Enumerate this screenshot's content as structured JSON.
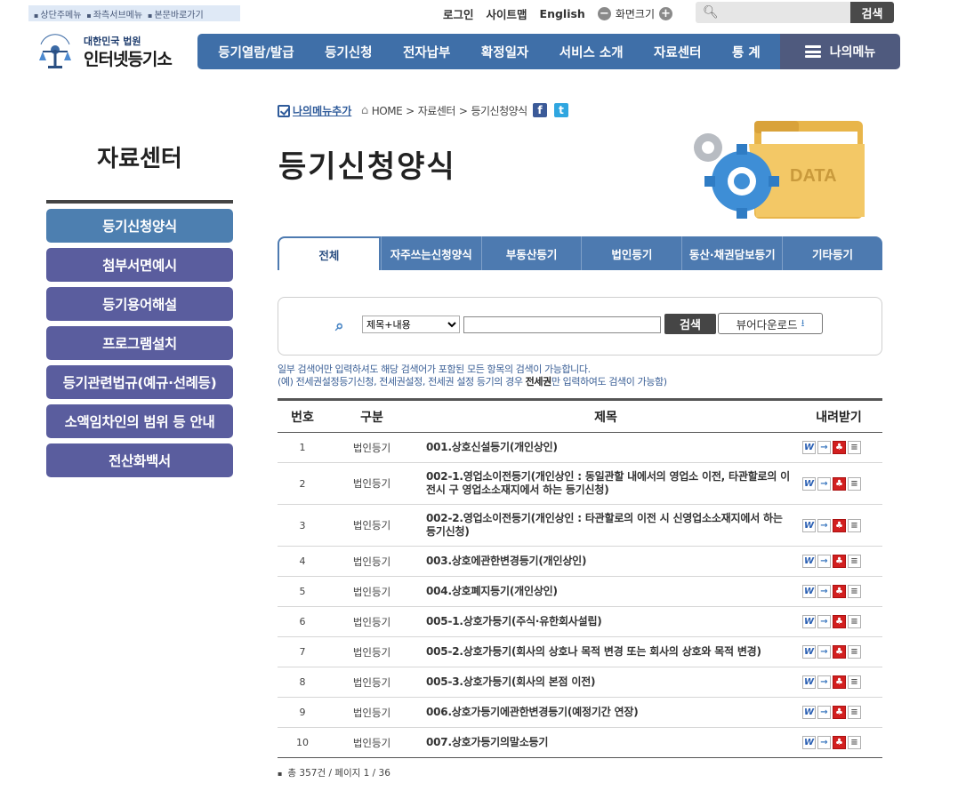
{
  "skipnav": [
    "상단주메뉴",
    "좌측서브메뉴",
    "본문바로가기"
  ],
  "util": {
    "login": "로그인",
    "sitemap": "사이트맵",
    "english": "English",
    "zoom_label": "화면크기",
    "search_button": "검색"
  },
  "logo": {
    "sub": "대한민국 법원",
    "main": "인터넷등기소",
    "emblem_text": "대한민국법원"
  },
  "gnb": [
    "등기열람/발급",
    "등기신청",
    "전자납부",
    "확정일자",
    "서비스 소개",
    "자료센터",
    "통 계"
  ],
  "mymenu": "나의메뉴",
  "sidebar": {
    "title": "자료센터",
    "items": [
      "등기신청양식",
      "첨부서면예시",
      "등기용어해설",
      "프로그램설치",
      "등기관련법규(예규·선례등)",
      "소액임차인의 범위 등 안내",
      "전산화백서"
    ],
    "active_index": 0
  },
  "breadcrumb": {
    "add_menu": "나의메뉴추가",
    "home": "HOME",
    "path1": "자료센터",
    "path2": "등기신청양식",
    "facebook": "f",
    "twitter": "t"
  },
  "page_title": "등기신청양식",
  "art_label": "DATA",
  "tabs": [
    "전체",
    "자주쓰는신청양식",
    "부동산등기",
    "법인등기",
    "동산·채권담보등기",
    "기타등기"
  ],
  "active_tab": 0,
  "search": {
    "select_value": "제목+내용",
    "input_value": "",
    "search_button": "검색",
    "viewer_button": "뷰어다운로드"
  },
  "hint": {
    "line1": "일부 검색어만 입력하셔도 해당 검색어가 포함된 모든 항목의 검색이 가능합니다.",
    "line2_pre": "(예) 전세권설정등기신청, 전세권설정, 전세권 설정 등기의 경우 ",
    "line2_bold": "전세권",
    "line2_post": "만 입력하여도 검색이 가능함)"
  },
  "table": {
    "headers": [
      "번호",
      "구분",
      "제목",
      "내려받기"
    ],
    "rows": [
      {
        "no": "1",
        "cat": "법인등기",
        "title": "001.상호신설등기(개인상인)"
      },
      {
        "no": "2",
        "cat": "법인등기",
        "title": "002-1.영업소이전등기(개인상인 : 동일관할 내에서의 영업소 이전, 타관할로의 이 전시 구 영업소소재지에서 하는 등기신청)"
      },
      {
        "no": "3",
        "cat": "법인등기",
        "title": "002-2.영업소이전등기(개인상인 : 타관할로의 이전 시 신영업소소재지에서 하는 등기신청)"
      },
      {
        "no": "4",
        "cat": "법인등기",
        "title": "003.상호에관한변경등기(개인상인)"
      },
      {
        "no": "5",
        "cat": "법인등기",
        "title": "004.상호폐지등기(개인상인)"
      },
      {
        "no": "6",
        "cat": "법인등기",
        "title": "005-1.상호가등기(주식·유한회사설립)"
      },
      {
        "no": "7",
        "cat": "법인등기",
        "title": "005-2.상호가등기(회사의 상호나 목적 변경 또는 회사의 상호와 목적 변경)"
      },
      {
        "no": "8",
        "cat": "법인등기",
        "title": "005-3.상호가등기(회사의 본점 이전)"
      },
      {
        "no": "9",
        "cat": "법인등기",
        "title": "006.상호가등기에관한변경등기(예정기간 연장)"
      },
      {
        "no": "10",
        "cat": "법인등기",
        "title": "007.상호가등기의말소등기"
      }
    ],
    "download_icons": [
      "word-icon",
      "hwp-icon",
      "pdf-icon",
      "text-icon"
    ],
    "row_heights": [
      34,
      47,
      47,
      34,
      34,
      34,
      34,
      34,
      34,
      34
    ]
  },
  "total": "총 357건 / 페이지 1 / 36",
  "colors": {
    "gnb": "#3f6fa8",
    "mymenu": "#4f5a7e",
    "sidebar_item": "#5a5d9e",
    "sidebar_active": "#4d7fb0",
    "tab": "#4d7ab0"
  }
}
